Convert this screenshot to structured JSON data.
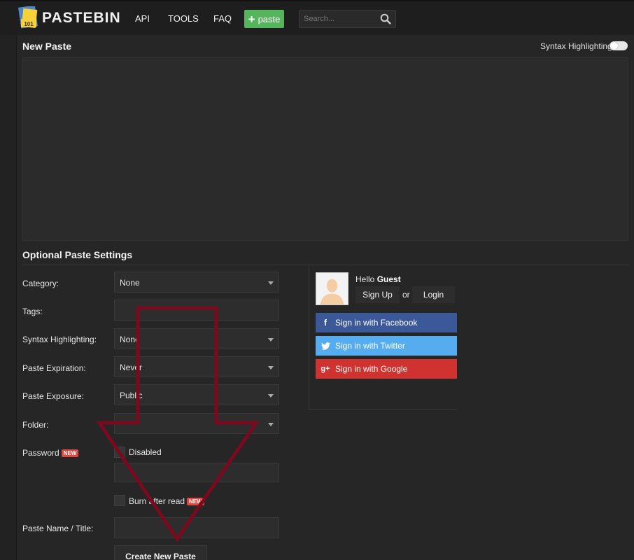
{
  "header": {
    "logo_text": "PASTEBIN",
    "logo_badge": "101",
    "nav": [
      "API",
      "TOOLS",
      "FAQ"
    ],
    "paste_button": "paste",
    "search_placeholder": "Search..."
  },
  "editor": {
    "title": "New Paste",
    "syntax_toggle_label": "Syntax Highlighting",
    "syntax_toggle_on": false
  },
  "settings": {
    "title": "Optional Paste Settings",
    "category": {
      "label": "Category:",
      "value": "None"
    },
    "tags": {
      "label": "Tags:",
      "value": ""
    },
    "syntax": {
      "label": "Syntax Highlighting:",
      "value": "None"
    },
    "expiration": {
      "label": "Paste Expiration:",
      "value": "Never"
    },
    "exposure": {
      "label": "Paste Exposure:",
      "value": "Public"
    },
    "folder": {
      "label": "Folder:",
      "value": ""
    },
    "password": {
      "label": "Password",
      "badge": "NEW",
      "checkbox_label": "Disabled",
      "value": ""
    },
    "burn": {
      "label": "Burn after read",
      "badge": "NEW"
    },
    "name": {
      "label": "Paste Name / Title:",
      "value": ""
    },
    "submit": "Create New Paste"
  },
  "sidebar": {
    "hello_prefix": "Hello",
    "username": "Guest",
    "signup": "Sign Up",
    "or": "or",
    "login": "Login",
    "facebook": "Sign in with Facebook",
    "twitter": "Sign in with Twitter",
    "google": "Sign in with Google"
  },
  "colors": {
    "accent_green": "#56b45d",
    "facebook": "#3b5998",
    "twitter": "#55acee",
    "google": "#d0322f",
    "new_badge": "#e2463f",
    "annotation_arrow": "#7a0a1e"
  },
  "icons": {
    "search": "search-icon",
    "plus": "plus-icon",
    "facebook": "facebook-icon",
    "twitter": "twitter-icon",
    "google": "google-plus-icon"
  }
}
